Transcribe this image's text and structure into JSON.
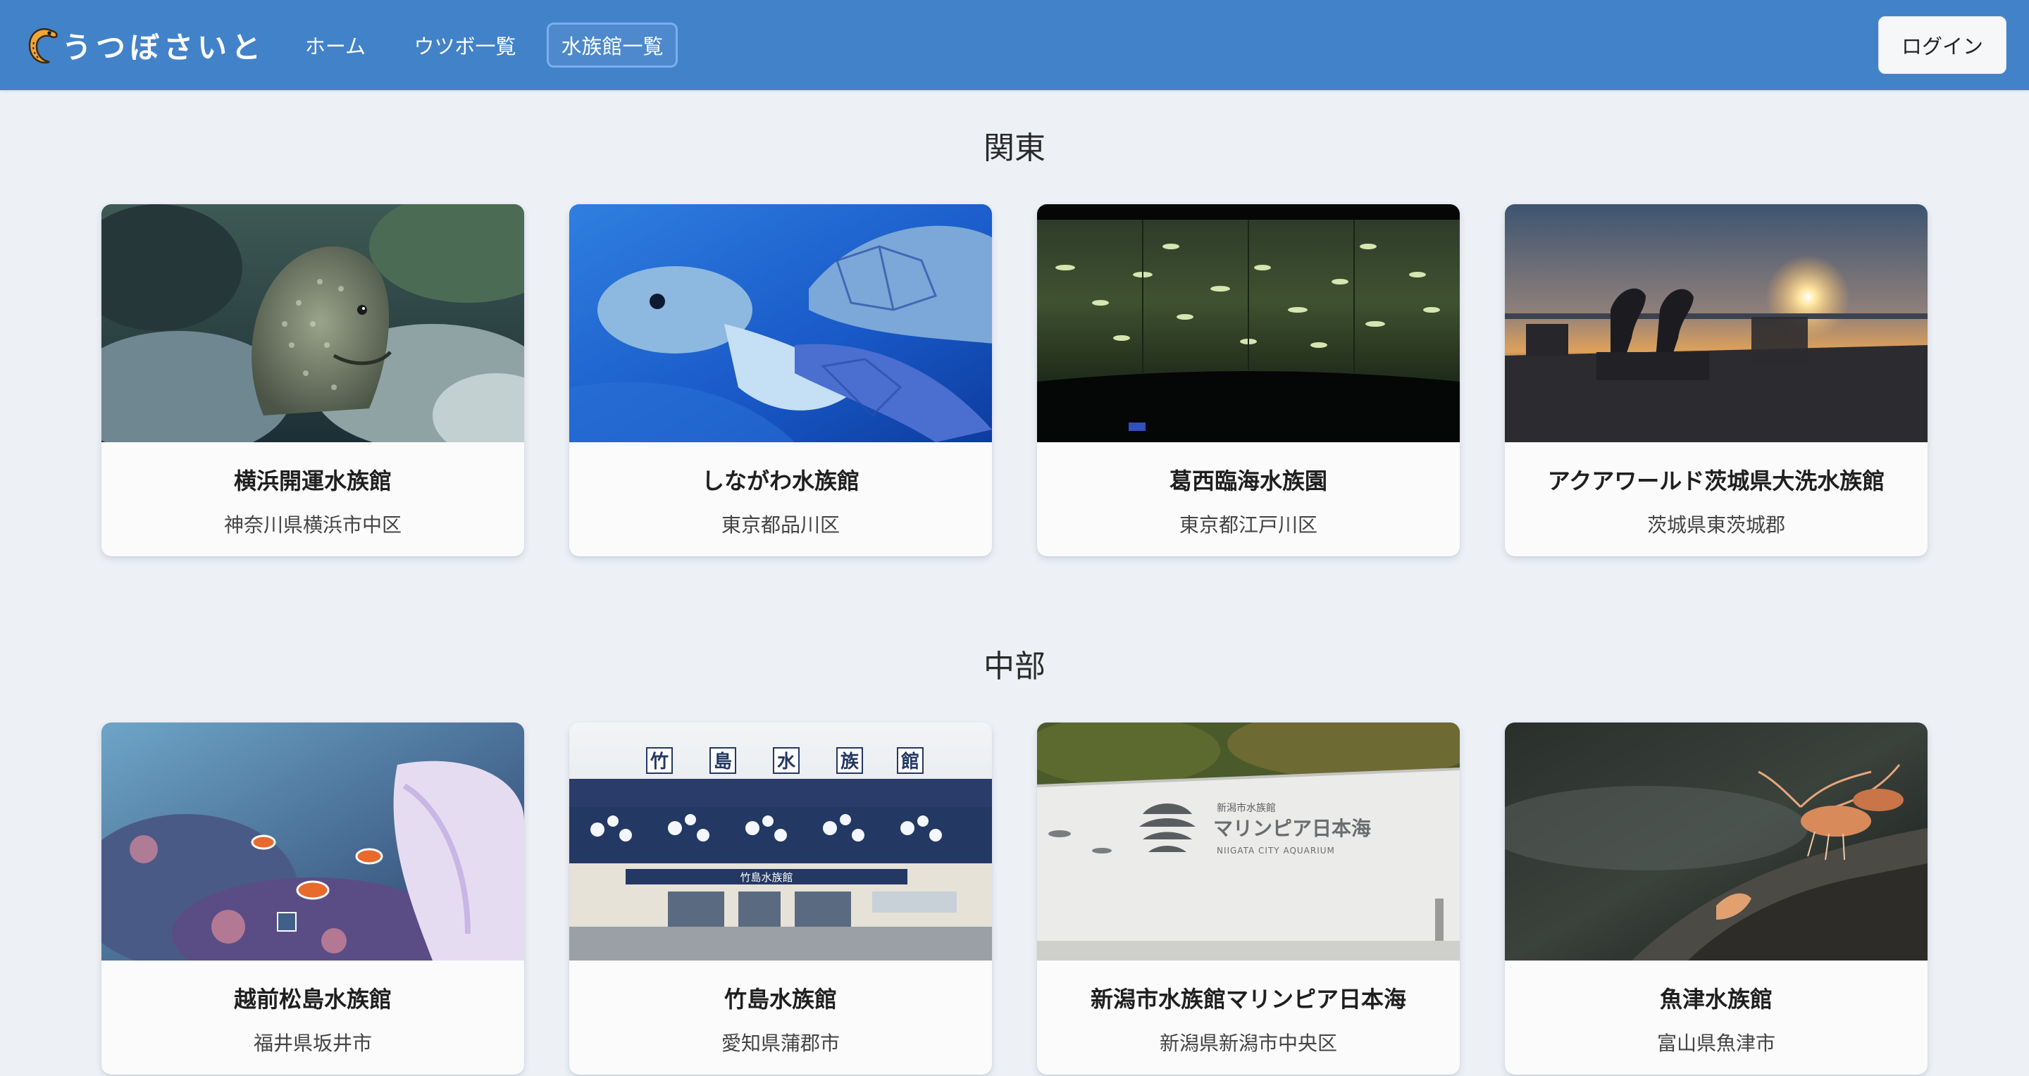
{
  "header": {
    "brand": "うつぼさいと",
    "nav": {
      "home": "ホーム",
      "moray_list": "ウツボ一覧",
      "aquarium_list": "水族館一覧"
    },
    "login": "ログイン",
    "colors": {
      "bar": "#4282c9",
      "active_border": "#7aaef0"
    }
  },
  "sections": [
    {
      "region": "関東",
      "cards": [
        {
          "name": "横浜開運水族館",
          "location": "神奈川県横浜市中区",
          "image": "moray-eel-photo"
        },
        {
          "name": "しながわ水族館",
          "location": "東京都品川区",
          "image": "sea-turtle-photo"
        },
        {
          "name": "葛西臨海水族園",
          "location": "東京都江戸川区",
          "image": "fish-tank-photo"
        },
        {
          "name": "アクアワールド茨城県大洗水族館",
          "location": "茨城県東茨城郡",
          "image": "sunset-dolphin-statue-photo"
        }
      ]
    },
    {
      "region": "中部",
      "cards": [
        {
          "name": "越前松島水族館",
          "location": "福井県坂井市",
          "image": "coral-reef-clownfish-photo"
        },
        {
          "name": "竹島水族館",
          "location": "愛知県蒲郡市",
          "image": "aquarium-building-photo"
        },
        {
          "name": "新潟市水族館マリンピア日本海",
          "location": "新潟県新潟市中央区",
          "image": "marinepia-sign-wall-photo"
        },
        {
          "name": "魚津水族館",
          "location": "富山県魚津市",
          "image": "shrimp-on-rock-photo"
        }
      ]
    }
  ],
  "image_text": {
    "takeshima_roof": [
      "竹",
      "島",
      "水",
      "族",
      "館"
    ],
    "takeshima_entrance": "竹島水族館",
    "marinepia_small": "新潟市水族館",
    "marinepia_main": "マリンピア日本海",
    "marinepia_en": "NIIGATA CITY AQUARIUM"
  }
}
